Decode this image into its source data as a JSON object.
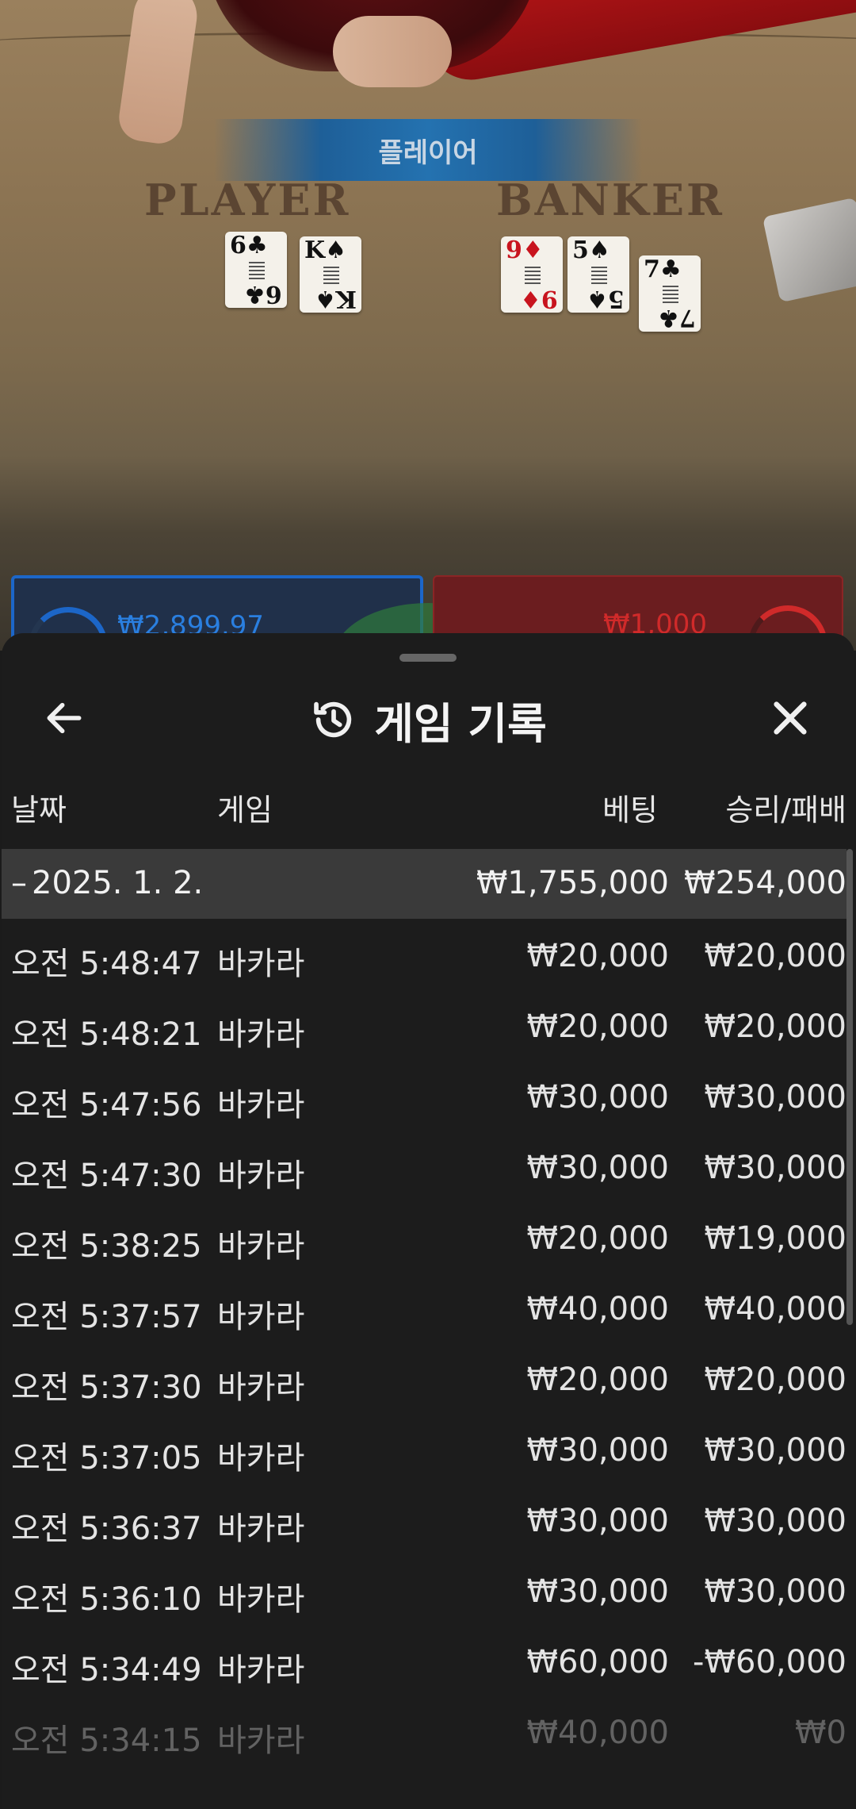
{
  "video": {
    "winner_banner": "플레이어",
    "player_label": "PLAYER",
    "banker_label": "BANKER",
    "player_cards": [
      {
        "rank": "6",
        "suit": "♣",
        "red": false
      },
      {
        "rank": "K",
        "suit": "♠",
        "red": false
      }
    ],
    "banker_cards": [
      {
        "rank": "9",
        "suit": "♦",
        "red": true
      },
      {
        "rank": "5",
        "suit": "♠",
        "red": false
      },
      {
        "rank": "7",
        "suit": "♣",
        "red": false
      }
    ],
    "player_bet": "₩2,899.97",
    "banker_bet": "₩1,000"
  },
  "sheet": {
    "title": "게임 기록",
    "title_icon": "history-icon",
    "back_icon": "arrow-left-icon",
    "close_icon": "close-icon",
    "columns": {
      "date": "날짜",
      "game": "게임",
      "bet": "베팅",
      "winloss": "승리/패배"
    },
    "date_group": {
      "toggle": "–",
      "date": "2025. 1. 2.",
      "total_bet": "₩1,755,000",
      "total_winloss": "₩254,000"
    },
    "rows": [
      {
        "time": "오전 5:48:47",
        "game": "바카라",
        "bet": "₩20,000",
        "winloss": "₩20,000"
      },
      {
        "time": "오전 5:48:21",
        "game": "바카라",
        "bet": "₩20,000",
        "winloss": "₩20,000"
      },
      {
        "time": "오전 5:47:56",
        "game": "바카라",
        "bet": "₩30,000",
        "winloss": "₩30,000"
      },
      {
        "time": "오전 5:47:30",
        "game": "바카라",
        "bet": "₩30,000",
        "winloss": "₩30,000"
      },
      {
        "time": "오전 5:38:25",
        "game": "바카라",
        "bet": "₩20,000",
        "winloss": "₩19,000"
      },
      {
        "time": "오전 5:37:57",
        "game": "바카라",
        "bet": "₩40,000",
        "winloss": "₩40,000"
      },
      {
        "time": "오전 5:37:30",
        "game": "바카라",
        "bet": "₩20,000",
        "winloss": "₩20,000"
      },
      {
        "time": "오전 5:37:05",
        "game": "바카라",
        "bet": "₩30,000",
        "winloss": "₩30,000"
      },
      {
        "time": "오전 5:36:37",
        "game": "바카라",
        "bet": "₩30,000",
        "winloss": "₩30,000"
      },
      {
        "time": "오전 5:36:10",
        "game": "바카라",
        "bet": "₩30,000",
        "winloss": "₩30,000"
      },
      {
        "time": "오전 5:34:49",
        "game": "바카라",
        "bet": "₩60,000",
        "winloss": "-₩60,000"
      },
      {
        "time": "오전 5:34:15",
        "game": "바카라",
        "bet": "₩40,000",
        "winloss": "₩0"
      }
    ]
  },
  "colors": {
    "sheet_bg": "#1c1c1c",
    "date_row_bg": "#3a3a3a",
    "player_blue": "#1c66c8",
    "banker_red": "#d02a2a"
  }
}
